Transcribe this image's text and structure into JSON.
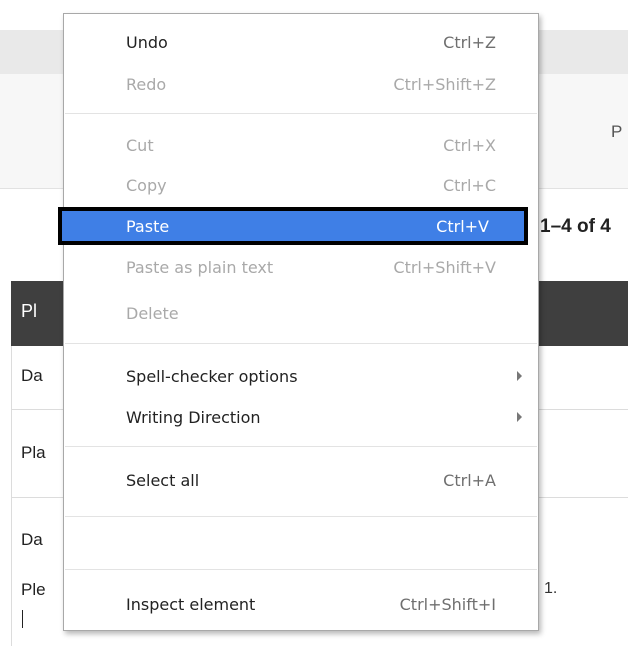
{
  "background": {
    "header_fragment": "P",
    "pager": "1–4 of 4",
    "dark_bar_fragment": "Pl",
    "rows": [
      {
        "fragment": "Da"
      },
      {
        "fragment": "Pla"
      },
      {
        "fragment": "Da"
      },
      {
        "fragment": "Ple",
        "trailing": "1."
      }
    ]
  },
  "context_menu": {
    "items": [
      {
        "label": "Undo",
        "shortcut": "Ctrl+Z",
        "enabled": true
      },
      {
        "label": "Redo",
        "shortcut": "Ctrl+Shift+Z",
        "enabled": false
      },
      {
        "label": "Cut",
        "shortcut": "Ctrl+X",
        "enabled": false
      },
      {
        "label": "Copy",
        "shortcut": "Ctrl+C",
        "enabled": false
      },
      {
        "label": "Paste",
        "shortcut": "Ctrl+V",
        "enabled": true,
        "highlighted": true
      },
      {
        "label": "Paste as plain text",
        "shortcut": "Ctrl+Shift+V",
        "enabled": false
      },
      {
        "label": "Delete",
        "shortcut": "",
        "enabled": false
      },
      {
        "label": "Spell-checker options",
        "submenu": true,
        "enabled": true
      },
      {
        "label": "Writing Direction",
        "submenu": true,
        "enabled": true
      },
      {
        "label": "Select all",
        "shortcut": "Ctrl+A",
        "enabled": true
      },
      {
        "label": "Inspect element",
        "shortcut": "Ctrl+Shift+I",
        "enabled": true
      }
    ]
  },
  "colors": {
    "highlight": "#3f7fe6",
    "dark_bar": "#3f3f3f"
  }
}
